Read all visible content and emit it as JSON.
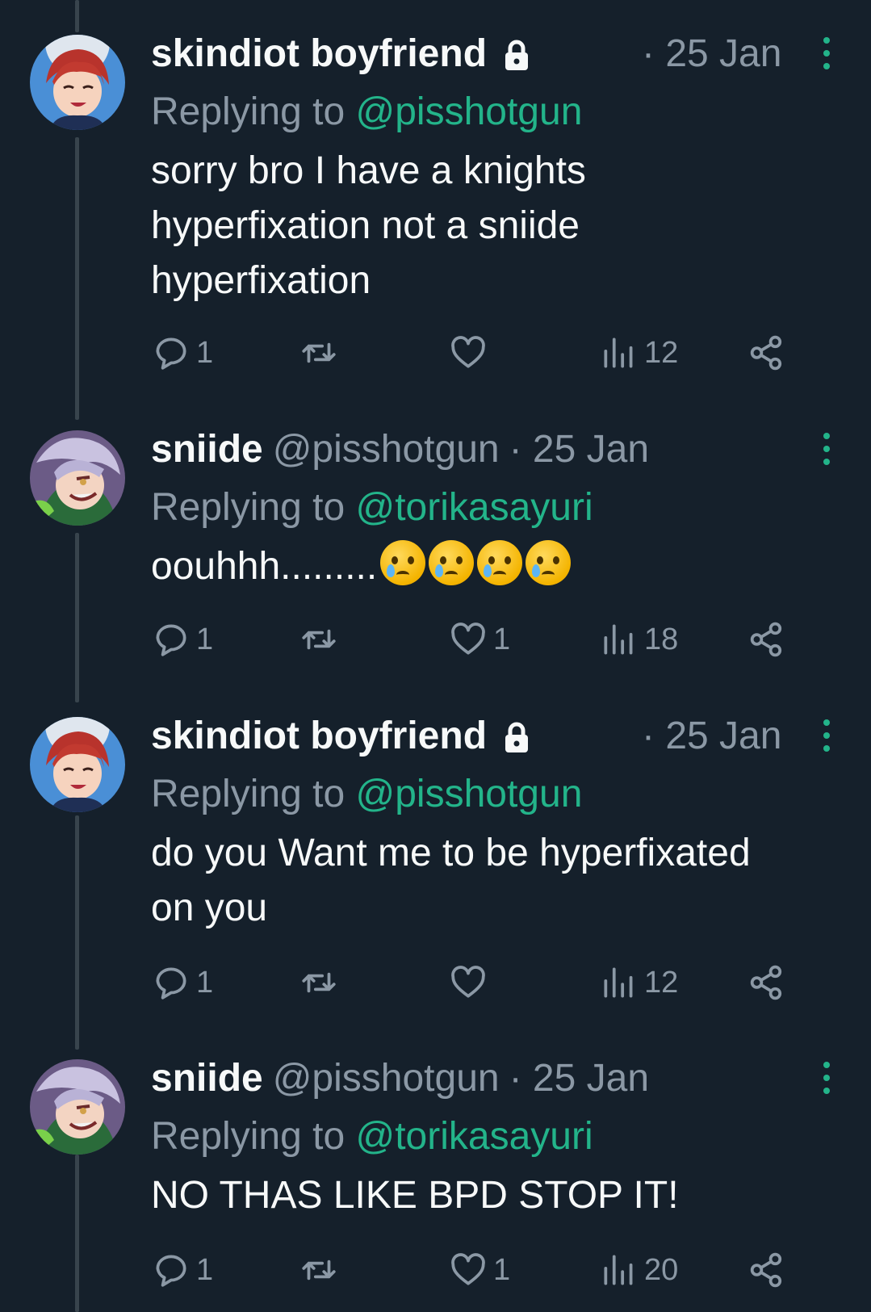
{
  "tweets": [
    {
      "name": "skindiot boyfriend",
      "locked": true,
      "handle": "",
      "date": "· 25 Jan",
      "reply_prefix": "Replying to ",
      "reply_to": "@pisshotgun",
      "text_lines": [
        "sorry bro I have a knights",
        "hyperfixation not a sniide",
        "hyperfixation"
      ],
      "replies": "1",
      "reposts": "",
      "likes": "",
      "views": "12"
    },
    {
      "name": "sniide",
      "locked": false,
      "handle": "@pisshotgun",
      "date": "· 25 Jan",
      "reply_prefix": "Replying to ",
      "reply_to": "@torikasayuri",
      "text": "oouhhh.........",
      "emoji": [
        "crying-face",
        "crying-face",
        "crying-face",
        "crying-face"
      ],
      "replies": "1",
      "reposts": "",
      "likes": "1",
      "views": "18"
    },
    {
      "name": "skindiot boyfriend",
      "locked": true,
      "handle": "",
      "date": "· 25 Jan",
      "reply_prefix": "Replying to ",
      "reply_to": "@pisshotgun",
      "text_lines": [
        "do you Want me to be hyperfixated",
        "on you"
      ],
      "replies": "1",
      "reposts": "",
      "likes": "",
      "views": "12"
    },
    {
      "name": "sniide",
      "locked": false,
      "handle": "@pisshotgun",
      "date": "· 25 Jan",
      "reply_prefix": "Replying to ",
      "reply_to": "@torikasayuri",
      "text_lines": [
        "NO THAS LIKE BPD STOP IT!"
      ],
      "replies": "1",
      "reposts": "",
      "likes": "1",
      "views": "20"
    }
  ],
  "colors": {
    "background": "#15202b",
    "text": "#f7f9f9",
    "muted": "#8b98a5",
    "accent": "#23b48a",
    "thread_line": "#38444d"
  }
}
